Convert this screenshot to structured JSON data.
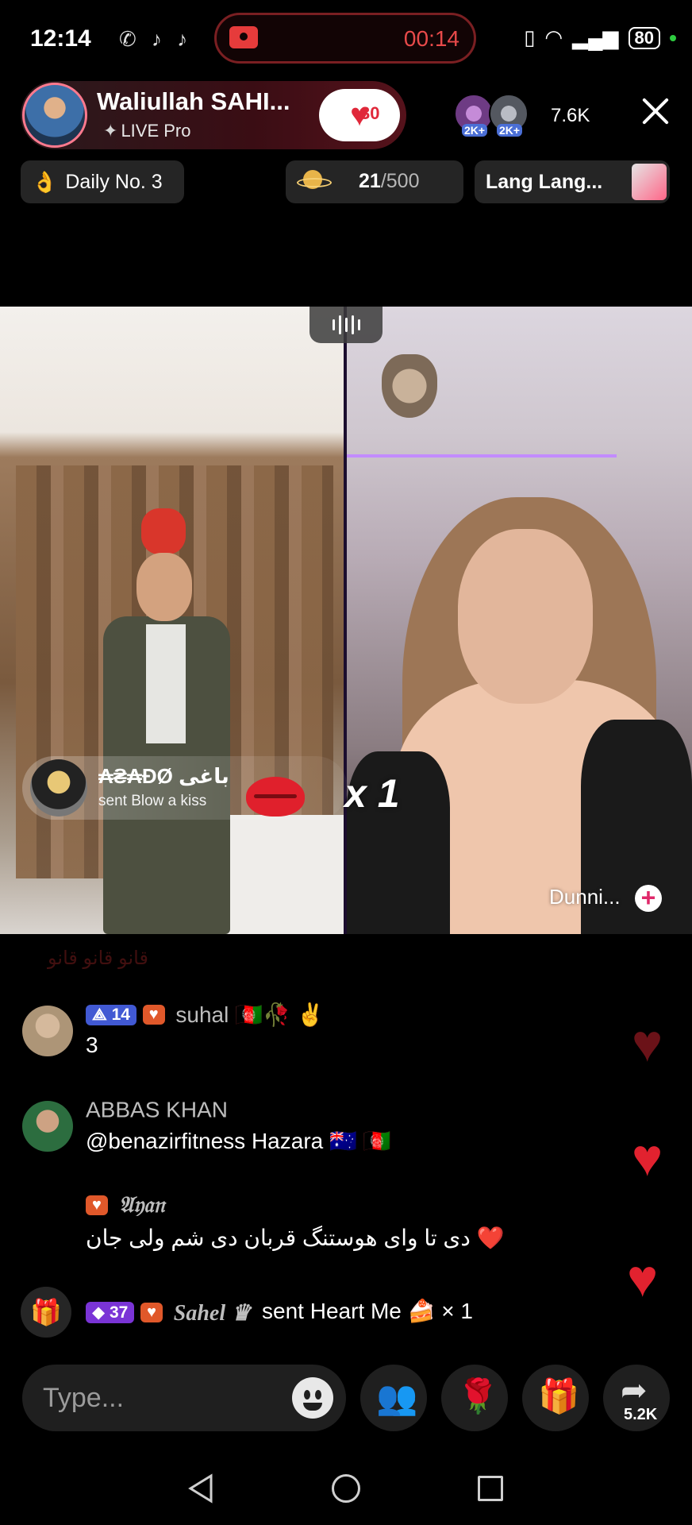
{
  "status_bar": {
    "time": "12:14",
    "record_time": "00:14",
    "battery": "80"
  },
  "host": {
    "name": "Waliullah SAHI...",
    "subtitle": "LIVE Pro",
    "like_count": "30"
  },
  "viewers": {
    "badge1": "2K+",
    "badge2": "2K+",
    "count": "7.6K"
  },
  "pills": {
    "daily": "Daily No. 3",
    "goal_current": "21",
    "goal_total": "/500",
    "lang": "Lang Lang..."
  },
  "gift_banner": {
    "sender": "₳₴₳ĐØ باغی",
    "text": "sent Blow a kiss",
    "multiplier": "x 1"
  },
  "guest": {
    "name": "Dunni..."
  },
  "chat": {
    "faded": "قانو قانو قانو",
    "messages": [
      {
        "level": "14",
        "user": "suhal 🇦🇫🥀 ✌️",
        "text": "3"
      },
      {
        "user": "ABBAS KHAN",
        "text": "@benazirfitness Hazara 🇦🇺 🇦🇫"
      },
      {
        "user": "𝔄𝔶𝔞𝔫",
        "text": "دی تا وای هوستنگ قربان دی شم ولی جان ❤️"
      }
    ],
    "gift_line": {
      "level": "37",
      "user": "Sahel ♛",
      "text": "sent Heart Me 🍰 × 1"
    }
  },
  "input": {
    "placeholder": "Type..."
  },
  "share_count": "5.2K",
  "colors": {
    "accent_red": "#e0283a",
    "live_banner": "#3a0d14"
  }
}
